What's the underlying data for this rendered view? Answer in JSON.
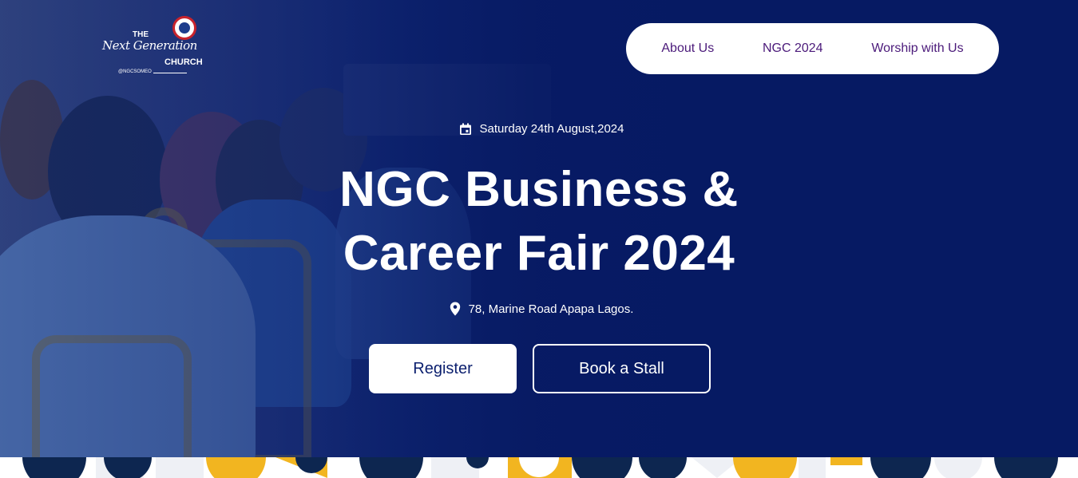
{
  "brand": {
    "logo_the": "THE",
    "logo_script": "Next Generation",
    "logo_church": "CHURCH",
    "logo_handle": "@NGCSOMEO"
  },
  "nav": {
    "items": [
      {
        "label": "About Us"
      },
      {
        "label": "NGC 2024"
      },
      {
        "label": "Worship with Us"
      }
    ]
  },
  "event": {
    "date": "Saturday 24th August,2024",
    "title_line1": "NGC Business &",
    "title_line2": "Career Fair 2024",
    "location": "78, Marine Road Apapa Lagos."
  },
  "actions": {
    "register_label": "Register",
    "stall_label": "Book a Stall"
  },
  "colors": {
    "hero_bg": "#071a63",
    "nav_text": "#4b1a7a",
    "register_text": "#0b1f6e",
    "pattern_yellow": "#f2b520",
    "pattern_navy": "#0d2650"
  }
}
